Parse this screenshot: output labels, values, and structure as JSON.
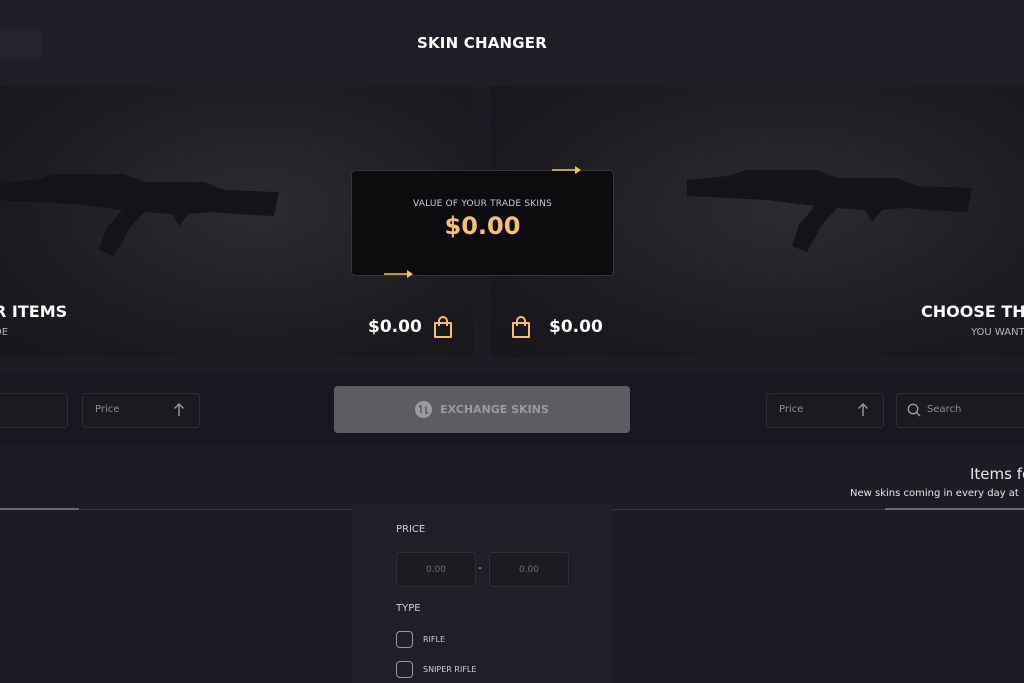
{
  "header": {
    "title": "SKIN CHANGER"
  },
  "left_panel": {
    "title": "R ITEMS",
    "subtitle": "DE",
    "price": "$0.00"
  },
  "right_panel": {
    "title": "CHOOSE THE",
    "subtitle": "YOU WANT",
    "price": "$0.00"
  },
  "trade_value": {
    "label": "VALUE OF YOUR TRADE SKINS",
    "amount": "$0.00"
  },
  "controls": {
    "left_sort_label": "Price",
    "right_sort_label": "Price",
    "search_placeholder": "Search",
    "exchange_label": "EXCHANGE SKINS"
  },
  "items_section": {
    "heading": "Items fo",
    "subheading": "New skins coming in every day at"
  },
  "filters": {
    "price_heading": "PRICE",
    "min_placeholder": "0.00",
    "max_placeholder": "0.00",
    "range_separator": "-",
    "type_heading": "TYPE",
    "types": [
      {
        "label": "RIFLE"
      },
      {
        "label": "SNIPER RIFLE"
      }
    ]
  },
  "colors": {
    "accent": "#f5c26b",
    "background": "#1c1c24",
    "panel": "#1f1f28"
  },
  "icons": [
    "bag-icon",
    "arrow-up-icon",
    "search-icon",
    "exchange-icon",
    "arrow-right-icon"
  ]
}
